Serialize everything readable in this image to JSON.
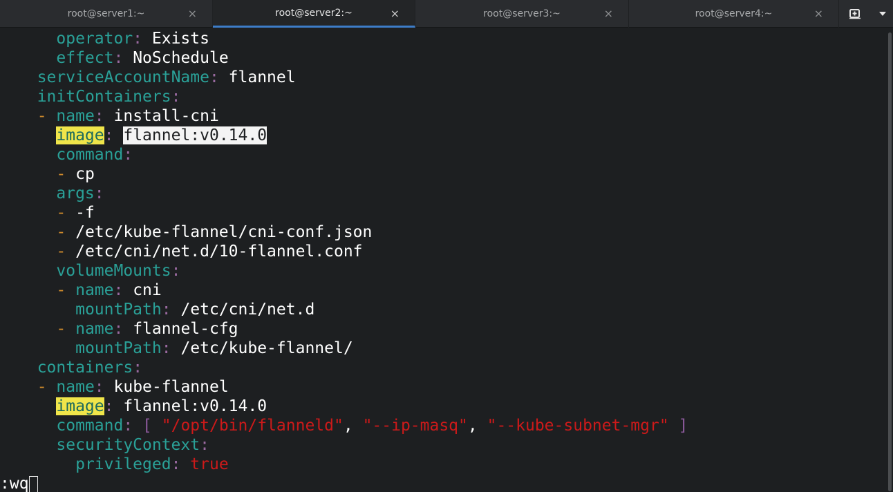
{
  "tabs": [
    {
      "label": "root@server1:~",
      "active": false
    },
    {
      "label": "root@server2:~",
      "active": true
    },
    {
      "label": "root@server3:~",
      "active": false
    },
    {
      "label": "root@server4:~",
      "active": false
    }
  ],
  "tab_close_glyph": "×",
  "icons": {
    "new_tab": "new-tab-icon",
    "menu": "menu-arrow-icon"
  },
  "colors": {
    "key": "#2aa198",
    "dash": "#d08b2c",
    "string": "#cc1a1a",
    "search_highlight": "#f0e54a",
    "active_tab_underline": "#3d7dc8"
  },
  "editor": {
    "lines": [
      {
        "indent": "    ",
        "dash": "",
        "key": "operator",
        "value": "Exists"
      },
      {
        "indent": "    ",
        "dash": "",
        "key": "effect",
        "value": "NoSchedule"
      },
      {
        "indent": "  ",
        "dash": "",
        "key": "serviceAccountName",
        "value": "flannel"
      },
      {
        "indent": "  ",
        "dash": "",
        "key": "initContainers",
        "value": ""
      },
      {
        "indent": "  ",
        "dash": "- ",
        "key": "name",
        "value": "install-cni"
      },
      {
        "indent": "    ",
        "dash": "",
        "key": "image",
        "value": "flannel:v0.14.0",
        "key_search_hl": true,
        "value_cursor_hl": true
      },
      {
        "indent": "    ",
        "dash": "",
        "key": "command",
        "value": ""
      },
      {
        "indent": "    ",
        "dash": "- ",
        "key": "",
        "value": "cp"
      },
      {
        "indent": "    ",
        "dash": "",
        "key": "args",
        "value": ""
      },
      {
        "indent": "    ",
        "dash": "- ",
        "key": "",
        "value": "-f"
      },
      {
        "indent": "    ",
        "dash": "- ",
        "key": "",
        "value": "/etc/kube-flannel/cni-conf.json"
      },
      {
        "indent": "    ",
        "dash": "- ",
        "key": "",
        "value": "/etc/cni/net.d/10-flannel.conf"
      },
      {
        "indent": "    ",
        "dash": "",
        "key": "volumeMounts",
        "value": ""
      },
      {
        "indent": "    ",
        "dash": "- ",
        "key": "name",
        "value": "cni"
      },
      {
        "indent": "      ",
        "dash": "",
        "key": "mountPath",
        "value": "/etc/cni/net.d"
      },
      {
        "indent": "    ",
        "dash": "- ",
        "key": "name",
        "value": "flannel-cfg"
      },
      {
        "indent": "      ",
        "dash": "",
        "key": "mountPath",
        "value": "/etc/kube-flannel/"
      },
      {
        "indent": "  ",
        "dash": "",
        "key": "containers",
        "value": ""
      },
      {
        "indent": "  ",
        "dash": "- ",
        "key": "name",
        "value": "kube-flannel"
      },
      {
        "indent": "    ",
        "dash": "",
        "key": "image",
        "value": "flannel:v0.14.0",
        "key_search_hl": true
      },
      {
        "indent": "    ",
        "dash": "",
        "key": "command",
        "value": "",
        "array": [
          "\"/opt/bin/flanneld\"",
          "\"--ip-masq\"",
          "\"--kube-subnet-mgr\""
        ]
      },
      {
        "indent": "    ",
        "dash": "",
        "key": "securityContext",
        "value": ""
      },
      {
        "indent": "      ",
        "dash": "",
        "key": "privileged",
        "value": "true",
        "bool": true
      }
    ],
    "command_line": ":wq"
  }
}
